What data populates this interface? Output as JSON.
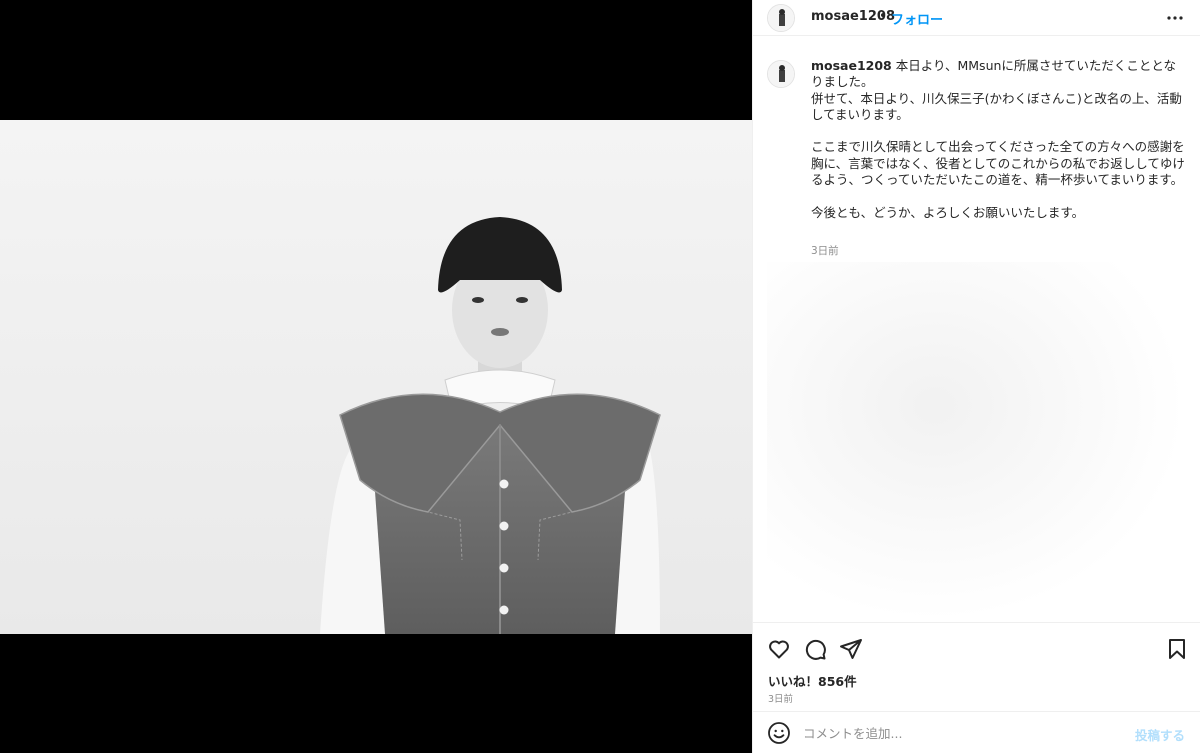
{
  "post": {
    "username": "mosae1208",
    "separator": "•",
    "follow_label": "フォロー",
    "more_icon": "more-horizontal-icon"
  },
  "caption": {
    "username": "mosae1208",
    "text": " 本日より、MMsunに所属させていただくこととなりました。\n併せて、本日より、川久保三子(かわくぼさんこ)と改名の上、活動してまいります。\n\nここまで川久保晴として出会ってくださった全ての方々への感謝を胸に、言葉ではなく、役者としてのこれからの私でお返ししてゆけるよう、つくっていただいたこの道を、精一杯歩いてまいります。\n\n今後とも、どうか、よろしくお願いいたします。",
    "time": "3日前"
  },
  "actions": {
    "like_icon": "heart-icon",
    "comment_icon": "comment-icon",
    "share_icon": "send-icon",
    "save_icon": "bookmark-icon"
  },
  "likes": "いいね！856件",
  "post_time": "3日前",
  "comment": {
    "emoji_icon": "smiley-icon",
    "placeholder": "コメントを追加...",
    "post_label": "投稿する"
  },
  "colors": {
    "accent": "#0095f6",
    "post_disabled": "#b2dffc",
    "muted": "#8e8e8e",
    "text": "#262626"
  }
}
